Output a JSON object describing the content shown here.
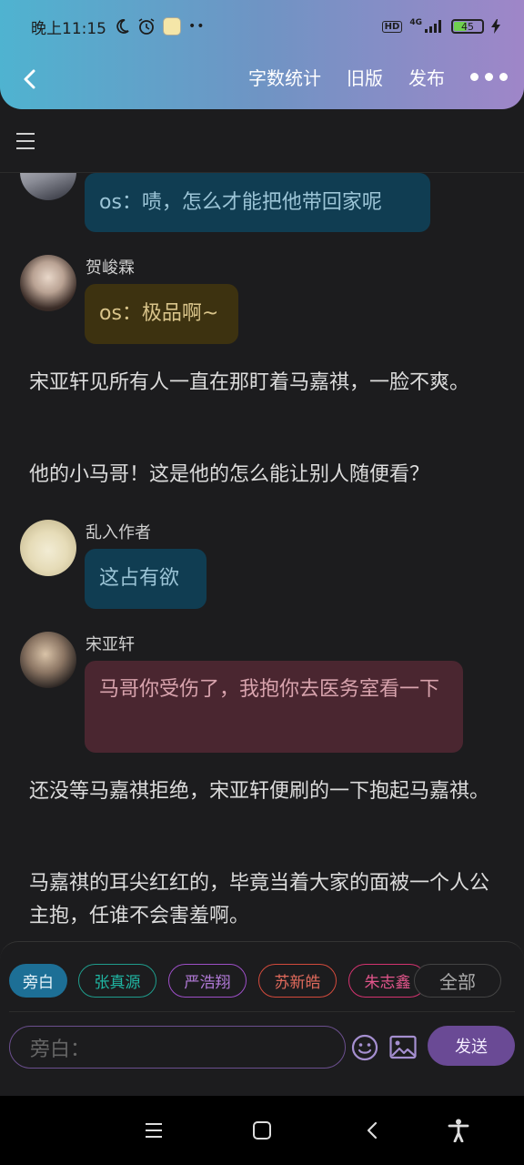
{
  "status_bar": {
    "time": "晚上11:15",
    "dots": "••",
    "hd": "HD",
    "network": "4G",
    "battery": "45"
  },
  "nav": {
    "actions": [
      "字数统计",
      "旧版",
      "发布"
    ]
  },
  "colors": {
    "header_gradient": [
      "#4fb3d0",
      "#6f94c4",
      "#9f86c8"
    ],
    "bubble_blue": "#103d52",
    "bubble_brown": "#3d3210",
    "bubble_red": "#4a2630",
    "send": "#6a4a95"
  },
  "messages": [
    {
      "type": "bubble",
      "speaker": "",
      "text": "os：啧，怎么才能把他带回家呢",
      "color": "blue"
    },
    {
      "type": "bubble",
      "speaker": "贺峻霖",
      "text": "os：极品啊~",
      "color": "brown"
    },
    {
      "type": "narration",
      "text": "宋亚轩见所有人一直在那盯着马嘉祺，一脸不爽。"
    },
    {
      "type": "narration",
      "text": "他的小马哥！这是他的怎么能让别人随便看？"
    },
    {
      "type": "bubble",
      "speaker": "乱入作者",
      "text": "这占有欲",
      "color": "blue"
    },
    {
      "type": "bubble",
      "speaker": "宋亚轩",
      "text": "马哥你受伤了，我抱你去医务室看一下",
      "color": "red"
    },
    {
      "type": "narration",
      "text": "还没等马嘉祺拒绝，宋亚轩便刷的一下抱起马嘉祺。"
    },
    {
      "type": "narration",
      "text": "马嘉祺的耳尖红红的，毕竟当着大家的面被一个人公主抱，任谁不会害羞啊。"
    }
  ],
  "characters": [
    {
      "label": "旁白",
      "color": "#1d6f96",
      "selected": true
    },
    {
      "label": "张真源",
      "color": "#1f9c8c",
      "selected": false
    },
    {
      "label": "严浩翔",
      "color": "#9d4fc7",
      "selected": false
    },
    {
      "label": "苏新皓",
      "color": "#d24a3c",
      "selected": false
    },
    {
      "label": "朱志鑫",
      "color": "#d3336f",
      "selected": false
    }
  ],
  "all_chip": "全部",
  "input": {
    "placeholder": "旁白："
  },
  "send_label": "发送",
  "icons": [
    "back-icon",
    "menu-icon",
    "emoji-icon",
    "image-icon",
    "send",
    "recent-apps-icon",
    "home-icon",
    "system-back-icon",
    "accessibility-icon"
  ]
}
